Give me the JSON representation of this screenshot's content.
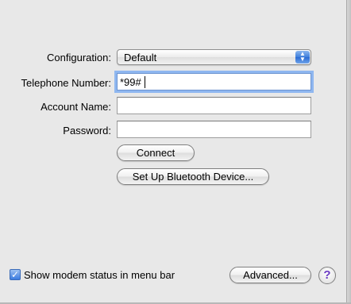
{
  "form": {
    "configuration_label": "Configuration:",
    "configuration_value": "Default",
    "telephone_label": "Telephone Number:",
    "telephone_value": "*99#",
    "account_label": "Account Name:",
    "account_value": "",
    "password_label": "Password:",
    "password_value": ""
  },
  "buttons": {
    "connect": "Connect",
    "bluetooth": "Set Up Bluetooth Device...",
    "advanced": "Advanced...",
    "help": "?"
  },
  "footer": {
    "status_checkbox_label": "Show modem status in menu bar",
    "status_checkbox_checked": true
  },
  "icons": {
    "popup": "up-down-arrows-icon",
    "checkbox": "checkmark-icon",
    "help": "question-mark-icon"
  },
  "colors": {
    "accent": "#3f7fdb",
    "focus_ring": "#8fb7f0",
    "help_glyph": "#6a3bc2"
  }
}
